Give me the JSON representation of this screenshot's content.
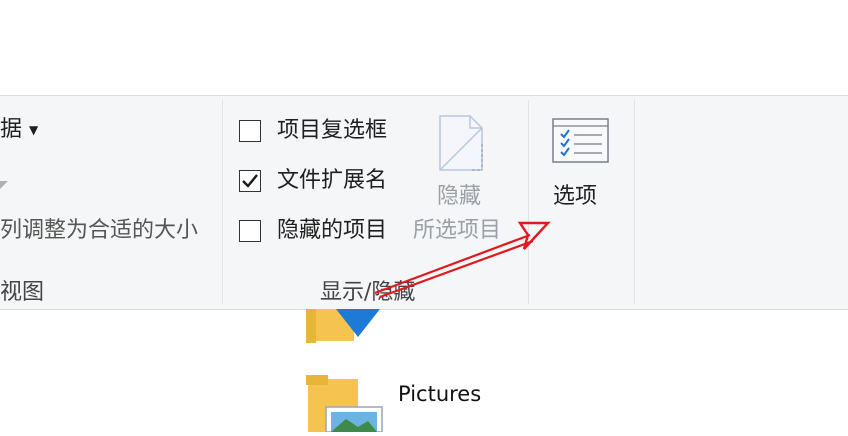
{
  "ribbon": {
    "layout_group": {
      "dropdown_label": "据",
      "fit_columns_label": "列调整为合适的大小",
      "group_label": "视图"
    },
    "show_hide_group": {
      "item_checkboxes": {
        "label": "项目复选框",
        "checked": false
      },
      "file_extensions": {
        "label": "文件扩展名",
        "checked": true
      },
      "hidden_items": {
        "label": "隐藏的项目",
        "checked": false
      },
      "hide_selected_label_line1": "隐藏",
      "hide_selected_label_line2": "所选项目",
      "group_label": "显示/隐藏"
    },
    "options_button": {
      "label": "选项"
    }
  },
  "files": [
    {
      "name": ""
    },
    {
      "name": "Pictures"
    }
  ],
  "colors": {
    "ribbon_bg": "#f5f6f7",
    "arrow": "#e0191e",
    "options_check": "#1e73d2",
    "folder": "#f5c450"
  }
}
